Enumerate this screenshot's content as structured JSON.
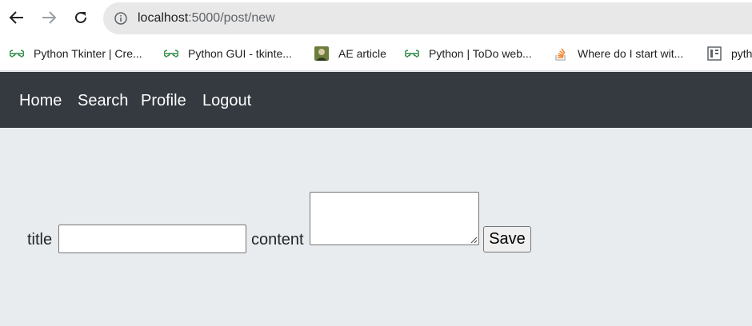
{
  "browser": {
    "url_host": "localhost",
    "url_path": ":5000/post/new",
    "bookmarks": [
      {
        "label": "Python Tkinter | Cre...",
        "icon": "geeksforgeeks-icon"
      },
      {
        "label": "Python GUI - tkinte...",
        "icon": "geeksforgeeks-icon"
      },
      {
        "label": "AE article",
        "icon": "avatar-icon"
      },
      {
        "label": "Python | ToDo web...",
        "icon": "geeksforgeeks-icon"
      },
      {
        "label": "Where do I start wit...",
        "icon": "stackoverflow-icon"
      },
      {
        "label": "pyth",
        "icon": "document-icon"
      }
    ]
  },
  "navbar": {
    "links": [
      "Home",
      "Search",
      "Profile",
      "Logout"
    ],
    "background": "#343a40"
  },
  "form": {
    "title_label": "title",
    "title_value": "",
    "content_label": "content",
    "content_value": "",
    "save_label": "Save"
  }
}
